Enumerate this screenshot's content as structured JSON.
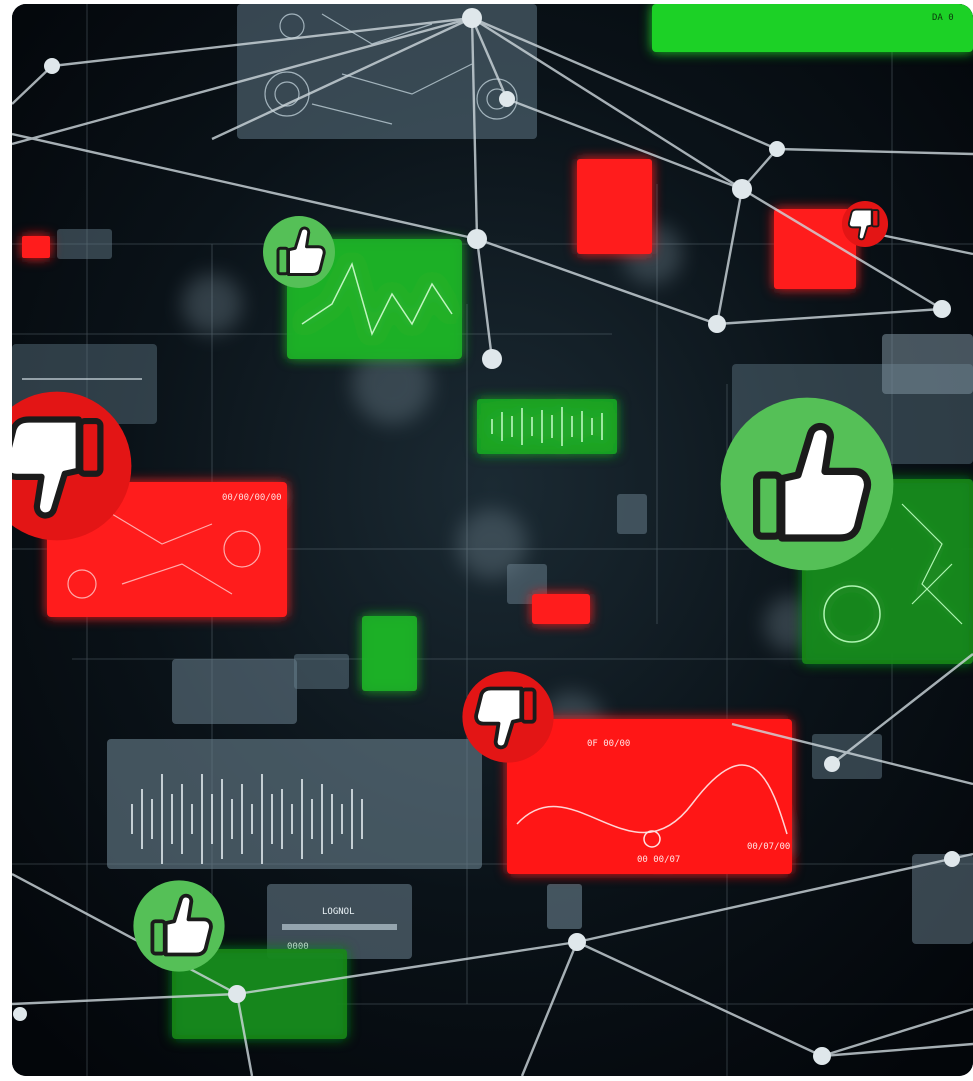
{
  "image": {
    "description_tag": "network-feedback-collage",
    "colors": {
      "background": "#05080c",
      "panel_grey": "#5f7785",
      "panel_green": "#1fd126",
      "panel_red": "#ff1f1f",
      "badge_green": "#55c057",
      "badge_red": "#e31515",
      "line": "#cfd9de",
      "hand_fill": "#ffffff",
      "hand_outline": "#1b1b1b"
    },
    "panel_texts": {
      "top_right": "DA 0",
      "red_left_header": "00/00/00/00",
      "red_bottom_header": "0F 00/00",
      "red_bottom_center": "00 00/07",
      "red_bottom_right": "00/07/00",
      "grey_bottom_title": "LOGNOL",
      "grey_bottom_sub": "0000"
    }
  }
}
